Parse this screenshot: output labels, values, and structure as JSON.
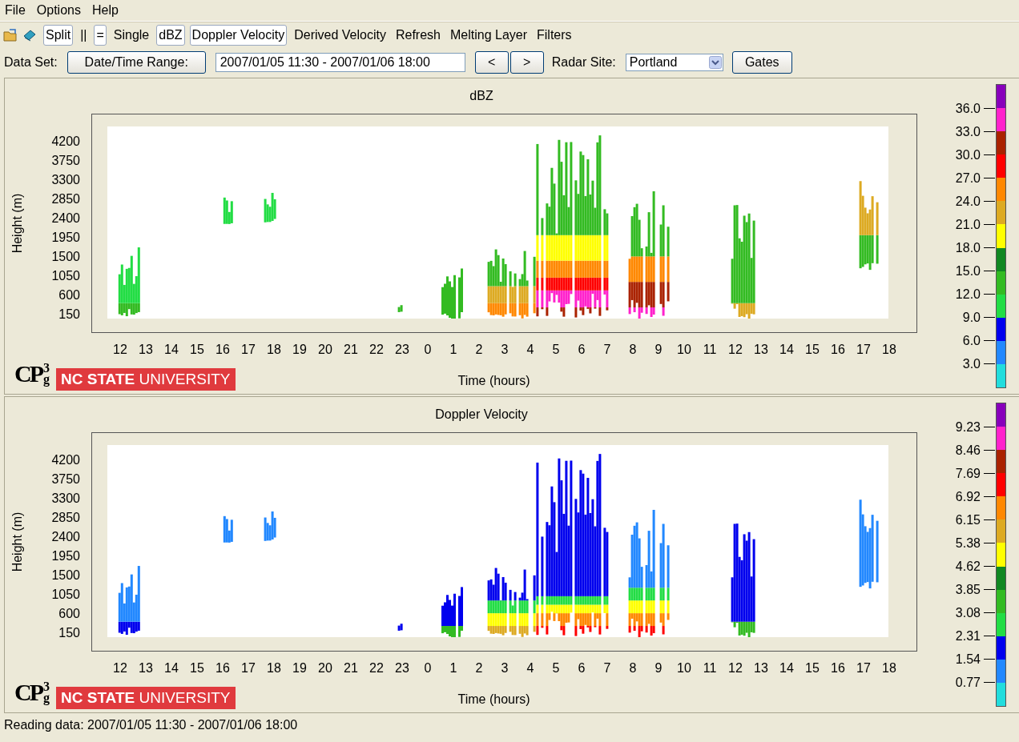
{
  "menu": [
    "File",
    "Options",
    "Help"
  ],
  "toolbar": [
    {
      "label": "Split",
      "selected": true
    },
    {
      "label": "||",
      "selected": false
    },
    {
      "label": "=",
      "selected": true
    },
    {
      "label": "Single",
      "selected": false
    },
    {
      "label": "dBZ",
      "selected": true
    },
    {
      "label": "Doppler Velocity",
      "selected": true
    },
    {
      "label": "Derived Velocity",
      "selected": false
    },
    {
      "label": "Refresh",
      "selected": false
    },
    {
      "label": "Melting Layer",
      "selected": false
    },
    {
      "label": "Filters",
      "selected": false
    }
  ],
  "dataset": {
    "label": "Data Set:",
    "range_button": "Date/Time Range:",
    "range_value": "2007/01/05 11:30 - 2007/01/06 18:00",
    "prev": "<",
    "next": ">",
    "site_label": "Radar Site:",
    "site": "Portland",
    "gates": "Gates"
  },
  "panels": [
    {
      "kind": "dbz",
      "title": "dBZ",
      "y_label": "Height (m)",
      "y_ticks": [
        "4200",
        "3750",
        "3300",
        "2850",
        "2400",
        "1950",
        "1500",
        "1050",
        "600",
        "150"
      ],
      "x_ticks": [
        "12",
        "13",
        "14",
        "15",
        "16",
        "17",
        "18",
        "19",
        "20",
        "21",
        "22",
        "23",
        "0",
        "1",
        "2",
        "3",
        "4",
        "5",
        "6",
        "7",
        "8",
        "9",
        "10",
        "11",
        "12",
        "13",
        "14",
        "15",
        "16",
        "17",
        "18"
      ],
      "x_label": "Time (hours)",
      "logo": {
        "main": "CP",
        "sup": "3",
        "sub": "g"
      },
      "university": "**NC STATE** UNIVERSITY",
      "scale_labels": [
        "36.0",
        "33.0",
        "30.0",
        "27.0",
        "24.0",
        "21.0",
        "18.0",
        "15.0",
        "12.0",
        "9.0",
        "6.0",
        "3.0"
      ]
    },
    {
      "kind": "velocity",
      "title": "Doppler Velocity",
      "y_label": "Height (m)",
      "y_ticks": [
        "4200",
        "3750",
        "3300",
        "2850",
        "2400",
        "1950",
        "1500",
        "1050",
        "600",
        "150"
      ],
      "x_ticks": [
        "12",
        "13",
        "14",
        "15",
        "16",
        "17",
        "18",
        "19",
        "20",
        "21",
        "22",
        "23",
        "0",
        "1",
        "2",
        "3",
        "4",
        "5",
        "6",
        "7",
        "8",
        "9",
        "10",
        "11",
        "12",
        "13",
        "14",
        "15",
        "16",
        "17",
        "18"
      ],
      "x_label": "Time (hours)",
      "logo": {
        "main": "CP",
        "sup": "3",
        "sub": "g"
      },
      "university": "**NC STATE** UNIVERSITY",
      "scale_labels": [
        "9.23",
        "8.46",
        "7.69",
        "6.92",
        "6.15",
        "5.38",
        "4.62",
        "3.85",
        "3.08",
        "2.31",
        "1.54",
        "0.77"
      ]
    }
  ],
  "colorbar": [
    {
      "color": "#8800bb"
    },
    {
      "color": "#ff22cc"
    },
    {
      "color": "#aa2200"
    },
    {
      "color": "#ff0000"
    },
    {
      "color": "#ff8800"
    },
    {
      "color": "#ddaa22"
    },
    {
      "color": "#ffff00"
    },
    {
      "color": "#118822"
    },
    {
      "color": "#33bb22"
    },
    {
      "color": "#22dd44"
    },
    {
      "color": "#0000ee"
    },
    {
      "color": "#2288ff"
    },
    {
      "color": "#22dddd"
    }
  ],
  "status": "Reading data: 2007/01/05 11:30 - 2007/01/06 18:00"
}
